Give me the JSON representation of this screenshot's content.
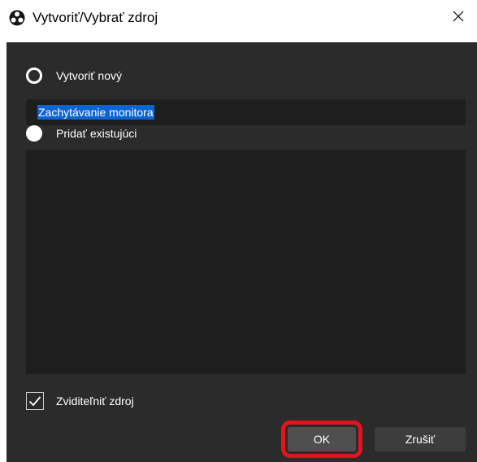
{
  "window": {
    "title": "Vytvoriť/Vybrať zdroj",
    "app_icon": "obs-logo-icon",
    "close_icon": "close-icon"
  },
  "options": {
    "create_new_label": "Vytvoriť nový",
    "create_new_selected": true,
    "add_existing_label": "Pridať existujúci",
    "add_existing_selected": false
  },
  "name_input": {
    "value": "Zachytávanie monitora"
  },
  "existing_sources": [],
  "visible_checkbox": {
    "label": "Zviditeľniť zdroj",
    "checked": true
  },
  "buttons": {
    "ok_label": "OK",
    "cancel_label": "Zrušiť"
  },
  "colors": {
    "background": "#2b2b2b",
    "input_background": "#1e1e1e",
    "selection": "#0a64d2",
    "highlight_border": "#e3141c"
  }
}
